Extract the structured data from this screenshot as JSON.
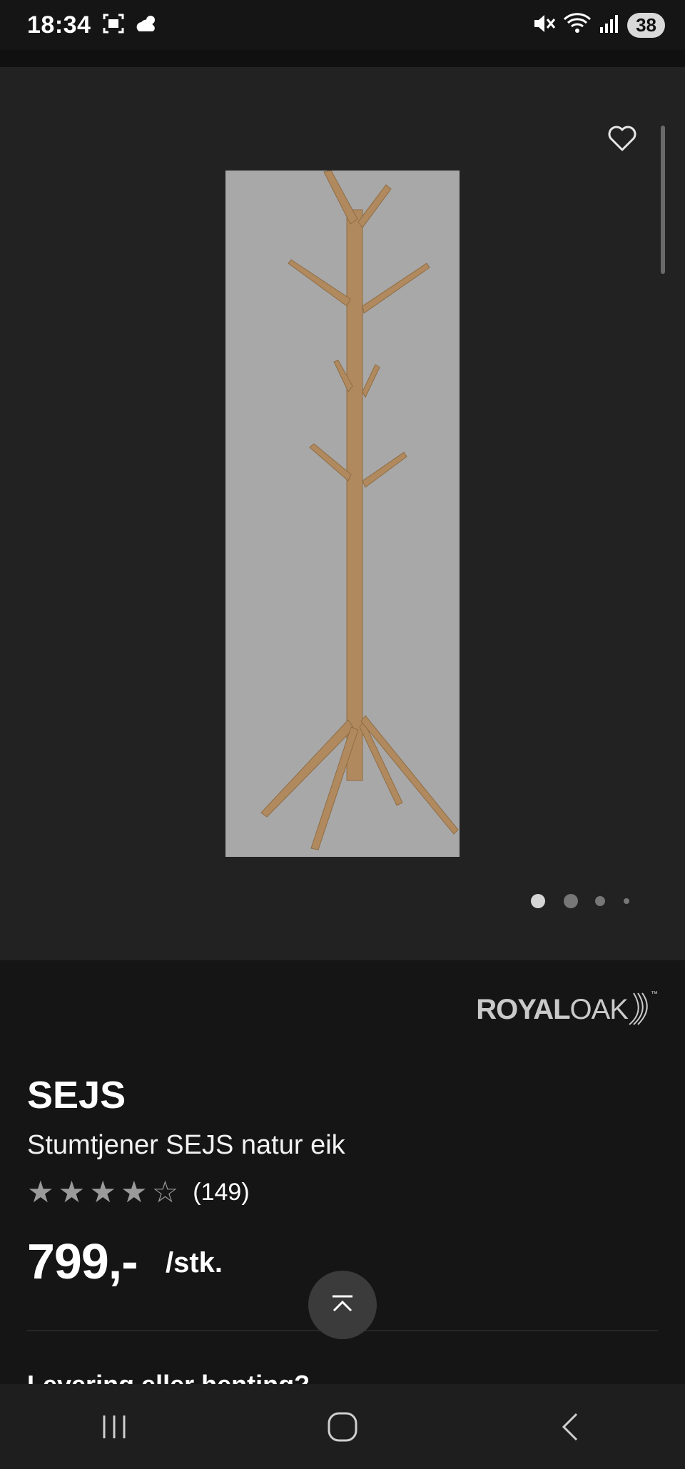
{
  "status_bar": {
    "time": "18:34",
    "battery": "38",
    "left_icons": [
      "screenshot-icon",
      "weather-icon"
    ],
    "right_icons": [
      "mute-icon",
      "wifi-icon",
      "signal-icon"
    ]
  },
  "gallery": {
    "image_alt": "coat-stand-image",
    "dots_count": 4,
    "active_dot": 0
  },
  "product": {
    "brand_part1": "ROYAL",
    "brand_part2": "OAK",
    "brand_tm": "™",
    "name": "SEJS",
    "description": "Stumtjener SEJS natur eik",
    "rating": 4.5,
    "reviews": "(149)",
    "price": "799,-",
    "unit": "/stk."
  },
  "section": {
    "delivery_heading": "Levering eller henting?"
  },
  "colors": {
    "background": "#151516",
    "gallery_bg": "#222223",
    "image_bg": "#a8a8a8",
    "wood": "#b08a5e"
  }
}
